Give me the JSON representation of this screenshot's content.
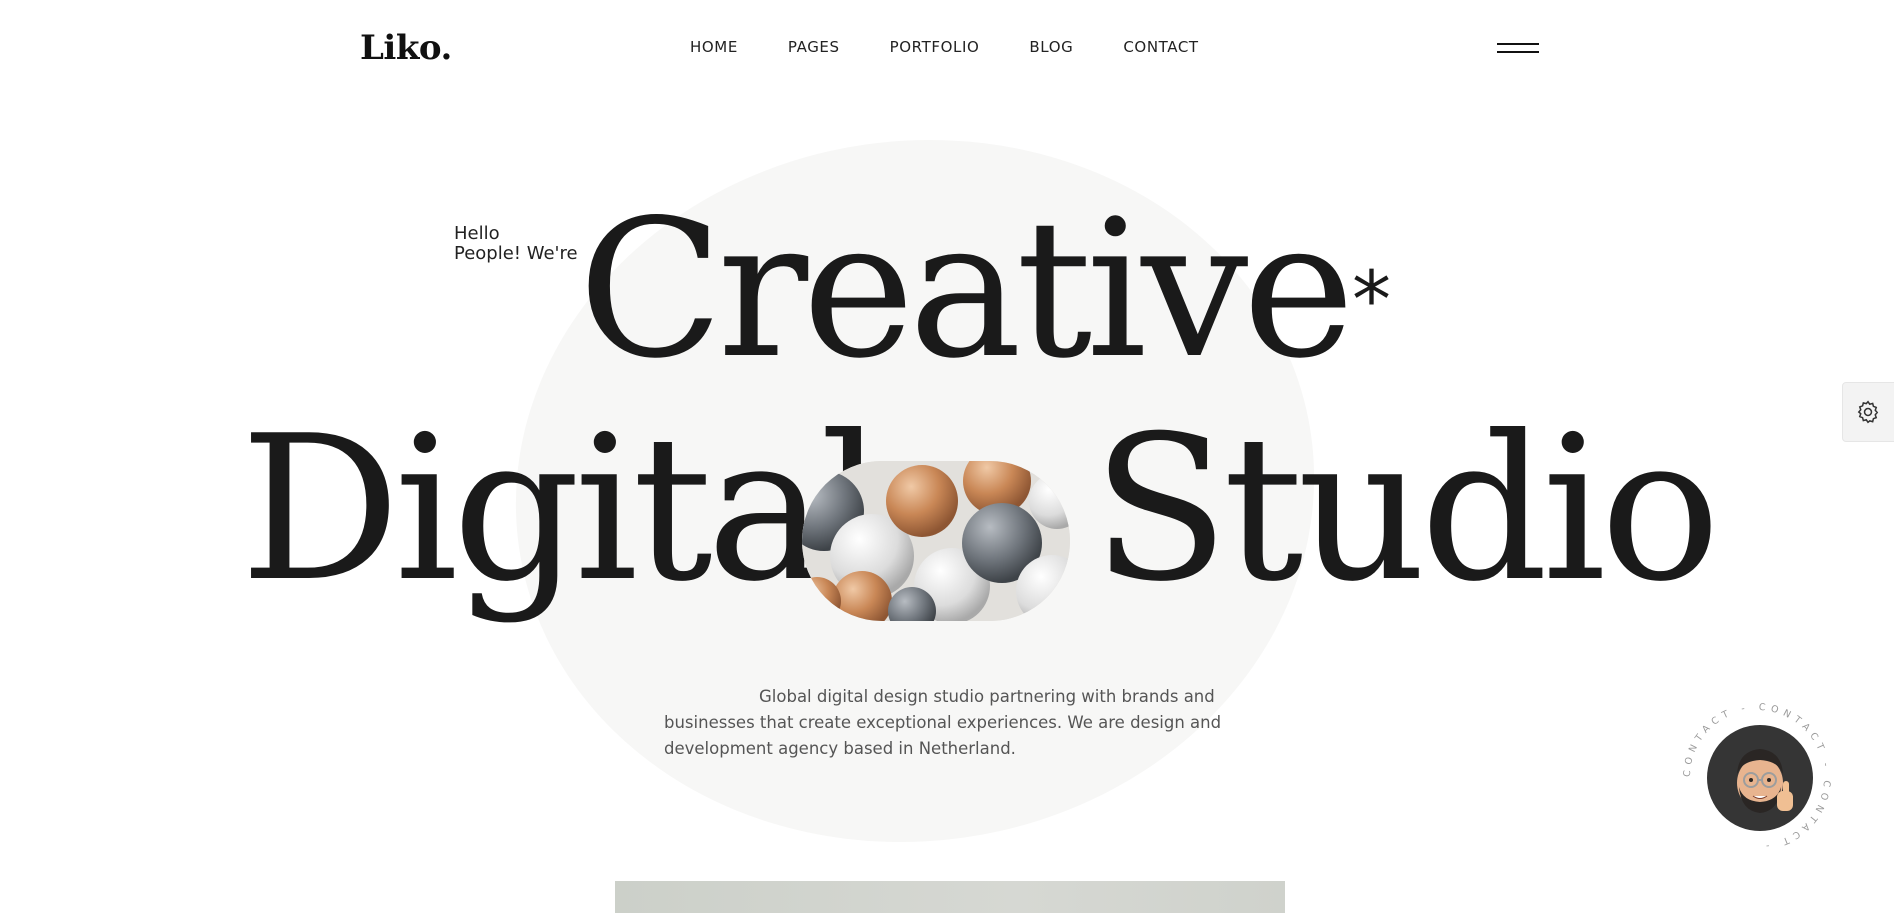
{
  "header": {
    "logo": "Liko.",
    "nav": [
      "HOME",
      "PAGES",
      "PORTFOLIO",
      "BLOG",
      "CONTACT"
    ]
  },
  "hero": {
    "greeting_line1": "Hello",
    "greeting_line2": "People! We're",
    "word1": "Creative",
    "asterisk": "*",
    "word2": "Digital",
    "word3": "Studio",
    "description": "Global digital design studio partnering with brands and businesses that create exceptional experiences. We are design and development agency based in Netherland."
  },
  "contact_badge": {
    "ring_text": "CONTACT - CONTACT - CONTACT -"
  },
  "icons": {
    "settings": "gear-icon",
    "menu": "hamburger-menu-icon"
  },
  "colors": {
    "text": "#1a1a1a",
    "blob": "#f7f7f6",
    "muted": "#555555"
  }
}
